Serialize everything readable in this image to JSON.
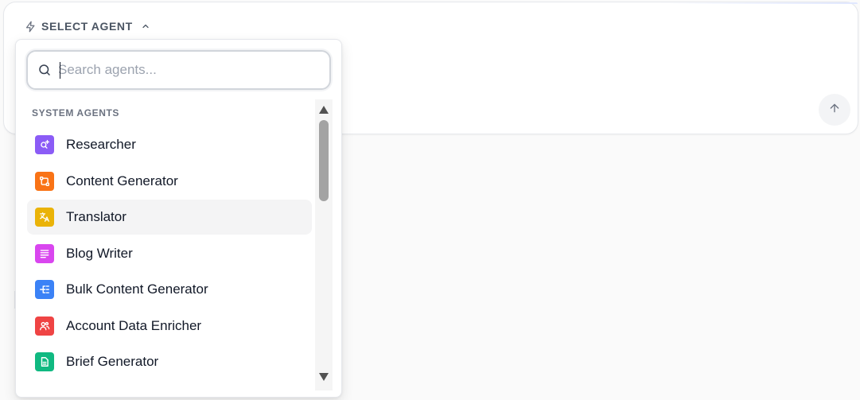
{
  "composer": {
    "select_agent_label": "SELECT AGENT",
    "send_icon": "arrow-up-icon",
    "select_icon": "lightning-icon",
    "toggle_icon": "chevron-up-icon"
  },
  "dropdown": {
    "search": {
      "placeholder": "Search agents...",
      "value": "",
      "icon": "search-icon"
    },
    "section_label": "SYSTEM AGENTS",
    "items": [
      {
        "label": "Researcher",
        "icon": "research-icon",
        "color": "#8b5cf6",
        "hovered": false
      },
      {
        "label": "Content Generator",
        "icon": "workflow-icon",
        "color": "#f97316",
        "hovered": false
      },
      {
        "label": "Translator",
        "icon": "translate-icon",
        "color": "#eab308",
        "hovered": true
      },
      {
        "label": "Blog Writer",
        "icon": "article-icon",
        "color": "#d946ef",
        "hovered": false
      },
      {
        "label": "Bulk Content Generator",
        "icon": "hierarchy-icon",
        "color": "#3b82f6",
        "hovered": false
      },
      {
        "label": "Account Data Enricher",
        "icon": "users-icon",
        "color": "#ef4444",
        "hovered": false
      },
      {
        "label": "Brief Generator",
        "icon": "document-icon",
        "color": "#10b981",
        "hovered": false
      }
    ]
  },
  "colors": {
    "hover_background": "#f4f4f5",
    "scrollbar_thumb": "#a3a3a3"
  }
}
